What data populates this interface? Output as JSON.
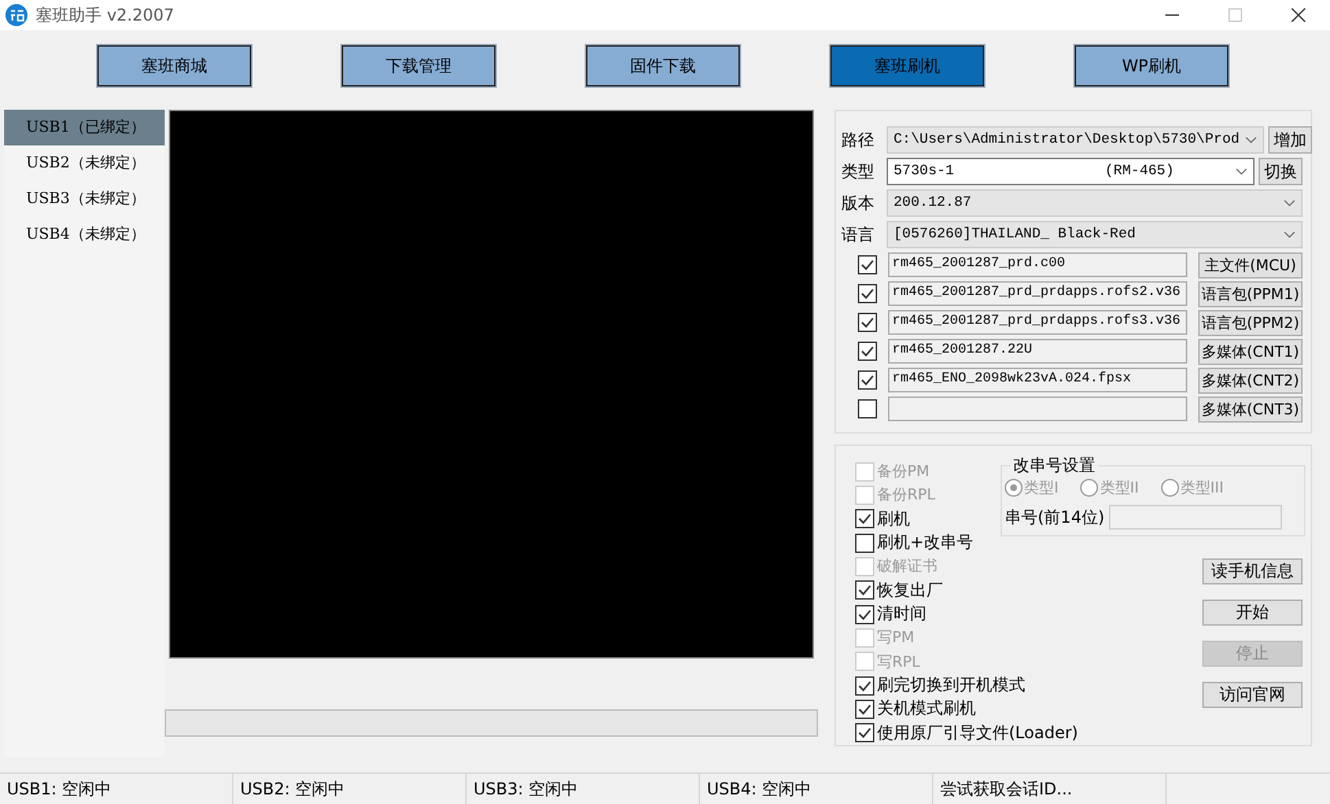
{
  "window": {
    "title": "塞班助手 v2.2007"
  },
  "nav_buttons": [
    {
      "label": "塞班商城",
      "selected": false
    },
    {
      "label": "下载管理",
      "selected": false
    },
    {
      "label": "固件下载",
      "selected": false
    },
    {
      "label": "塞班刷机",
      "selected": true
    },
    {
      "label": "WP刷机",
      "selected": false
    }
  ],
  "usb_list": [
    {
      "label": "USB1（已绑定）",
      "selected": true
    },
    {
      "label": "USB2（未绑定）",
      "selected": false
    },
    {
      "label": "USB3（未绑定）",
      "selected": false
    },
    {
      "label": "USB4（未绑定）",
      "selected": false
    }
  ],
  "progress_bar": {
    "level": 0
  },
  "firmware": {
    "path": {
      "label": "路径",
      "value": "C:\\Users\\Administrator\\Desktop\\5730\\Prod",
      "button": "增加"
    },
    "type": {
      "label": "类型",
      "value": "5730s-1",
      "model": "(RM-465)",
      "button": "切换"
    },
    "version": {
      "label": "版本",
      "value": "200.12.87"
    },
    "language": {
      "label": "语言",
      "value": "[0576260]THAILAND_ Black-Red"
    }
  },
  "files": [
    {
      "checked": true,
      "file": "rm465_2001287_prd.c00",
      "button": "主文件(MCU)"
    },
    {
      "checked": true,
      "file": "rm465_2001287_prd_prdapps.rofs2.v36",
      "button": "语言包(PPM1)"
    },
    {
      "checked": true,
      "file": "rm465_2001287_prd_prdapps.rofs3.v36",
      "button": "语言包(PPM2)"
    },
    {
      "checked": true,
      "file": "rm465_2001287.22U",
      "button": "多媒体(CNT1)"
    },
    {
      "checked": true,
      "file": "rm465_ENO_2098wk23vA.024.fpsx",
      "button": "多媒体(CNT2)"
    },
    {
      "checked": false,
      "button": "多媒体(CNT3)"
    }
  ],
  "options": [
    {
      "label": "备份PM",
      "checked": false,
      "disabled": true
    },
    {
      "label": "备份RPL",
      "checked": false,
      "disabled": true
    },
    {
      "label": "刷机",
      "checked": true,
      "disabled": false
    },
    {
      "label": "刷机+改串号",
      "checked": false,
      "disabled": false
    },
    {
      "label": "破解证书",
      "checked": false,
      "disabled": true
    },
    {
      "label": "恢复出厂",
      "checked": true,
      "disabled": false
    },
    {
      "label": "清时间",
      "checked": true,
      "disabled": false
    },
    {
      "label": "写PM",
      "checked": false,
      "disabled": true
    },
    {
      "label": "写RPL",
      "checked": false,
      "disabled": true
    },
    {
      "label": "刷完切换到开机模式",
      "checked": true,
      "disabled": false
    },
    {
      "label": "关机模式刷机",
      "checked": true,
      "disabled": false
    },
    {
      "label": "使用原厂引导文件(Loader)",
      "checked": true,
      "disabled": false
    }
  ],
  "serial_settings": {
    "title": "改串号设置",
    "disabled": true,
    "radios": [
      {
        "label": "类型I",
        "selected": true
      },
      {
        "label": "类型II",
        "selected": false
      },
      {
        "label": "类型III",
        "selected": false
      }
    ],
    "serial_label": "串号(前14位)"
  },
  "action_buttons": [
    {
      "label": "读手机信息",
      "disabled": false
    },
    {
      "label": "开始",
      "disabled": false
    },
    {
      "label": "停止",
      "disabled": true
    },
    {
      "label": "访问官网",
      "disabled": false
    }
  ],
  "status_bar": [
    "USB1: 空闲中",
    "USB2: 空闲中",
    "USB3: 空闲中",
    "USB4: 空闲中",
    "尝试获取会话ID..."
  ]
}
